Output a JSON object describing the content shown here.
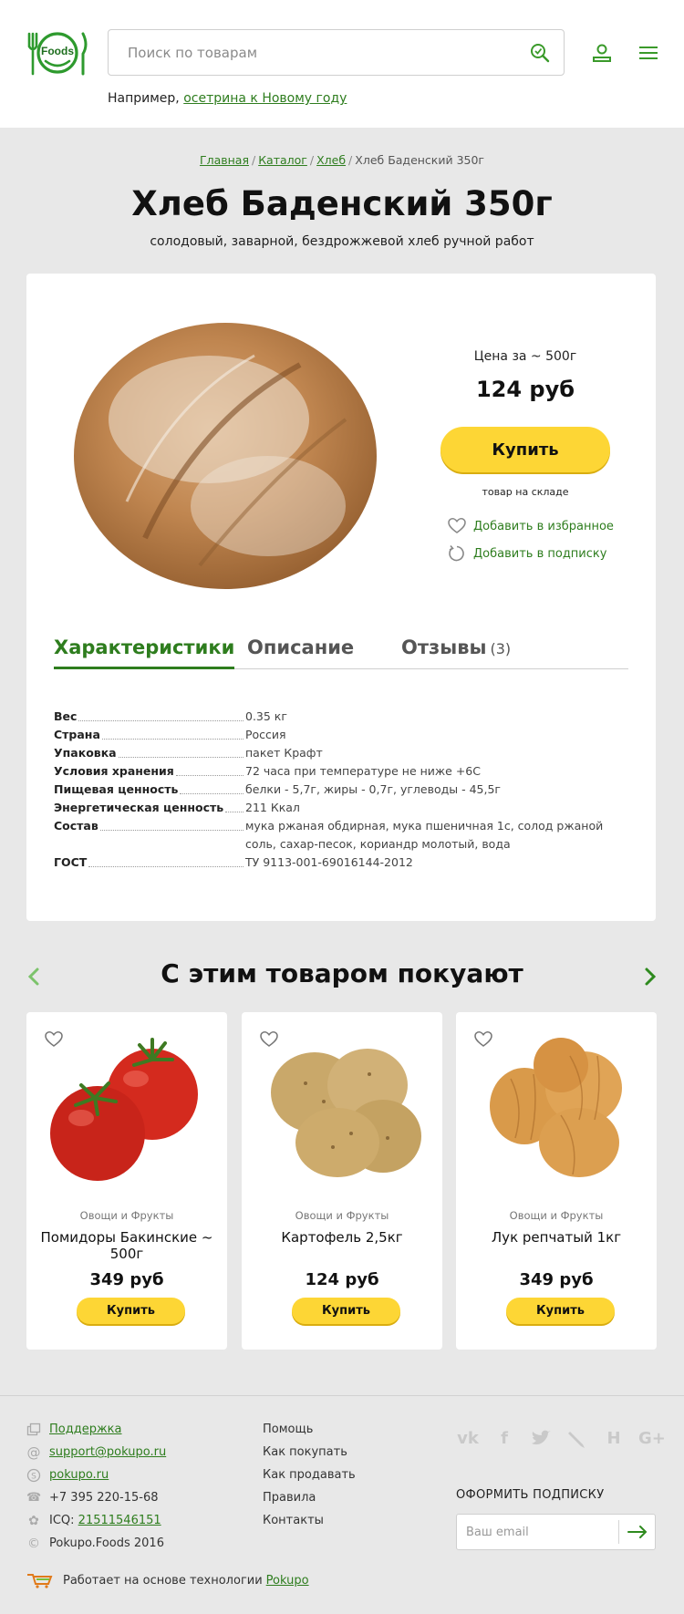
{
  "header": {
    "logo_text": "Foods",
    "search_placeholder": "Поиск по товарам",
    "example_prefix": "Например,",
    "example_link": "осетрина к Новому году"
  },
  "breadcrumb": [
    {
      "label": "Главная",
      "link": true
    },
    {
      "label": "Каталог",
      "link": true
    },
    {
      "label": "Хлеб",
      "link": true
    },
    {
      "label": "Хлеб Баденский 350г",
      "link": false
    }
  ],
  "product": {
    "title": "Хлеб Баденский 350г",
    "subtitle": "солодовый, заварной, бездрожжевой хлеб ручной работ",
    "price_label": "Цена за ~ 500г",
    "price": "124 руб",
    "buy_label": "Купить",
    "stock": "товар на складе",
    "favorite_label": "Добавить в избранное",
    "subscribe_label": "Добавить в подписку"
  },
  "tabs": [
    {
      "label": "Характеристики",
      "count": "",
      "active": true
    },
    {
      "label": "Описание",
      "count": "",
      "active": false
    },
    {
      "label": "Отзывы",
      "count": "(3)",
      "active": false
    }
  ],
  "specs": [
    {
      "name": "Вес",
      "value": "0.35 кг"
    },
    {
      "name": "Страна",
      "value": "Россия"
    },
    {
      "name": "Упаковка",
      "value": "пакет Крафт"
    },
    {
      "name": "Условия хранения",
      "value": "72 часа при температуре не ниже +6С"
    },
    {
      "name": "Пищевая ценность",
      "value": "белки - 5,7г, жиры - 0,7г, углеводы - 45,5г"
    },
    {
      "name": "Энергетическая ценность",
      "value": "211 Ккал"
    },
    {
      "name": "Состав",
      "value": "мука ржаная обдирная, мука пшеничная 1с, солод ржаной соль, сахар-песок, кориандр молотый, вода"
    },
    {
      "name": "ГОСТ",
      "value": "ТУ 9113-001-69016144-2012"
    }
  ],
  "related": {
    "title": "С этим товаром покуают",
    "items": [
      {
        "category": "Овощи и Фрукты",
        "name": "Помидоры Бакинские ~ 500г",
        "price": "349 руб",
        "buy_label": "Купить",
        "image": "tomatoes"
      },
      {
        "category": "Овощи и Фрукты",
        "name": "Картофель 2,5кг",
        "price": "124 руб",
        "buy_label": "Купить",
        "image": "potatoes"
      },
      {
        "category": "Овощи и Фрукты",
        "name": "Лук репчатый 1кг",
        "price": "349 руб",
        "buy_label": "Купить",
        "image": "onions"
      }
    ]
  },
  "footer": {
    "contacts": [
      {
        "icon": "support-icon",
        "text": "Поддержка",
        "link": true
      },
      {
        "icon": "at-icon",
        "text": "support@pokupo.ru",
        "link": true
      },
      {
        "icon": "skype-icon",
        "text": "pokupo.ru",
        "link": true
      },
      {
        "icon": "phone-icon",
        "text": "+7 395 220-15-68",
        "link": false
      },
      {
        "icon": "icq-icon",
        "text": "ICQ:",
        "link_text": "21511546151",
        "link": false
      },
      {
        "icon": "copyright-icon",
        "text": "Pokupo.Foods 2016",
        "link": false
      }
    ],
    "links": [
      "Помощь",
      "Как покупать",
      "Как продавать",
      "Правила",
      "Контакты"
    ],
    "social": [
      "vk-icon",
      "facebook-icon",
      "twitter-icon",
      "livejournal-icon",
      "habr-icon",
      "google-plus-icon"
    ],
    "subscribe_title": "ОФОРМИТЬ ПОДПИСКУ",
    "email_placeholder": "Ваш email",
    "powered_text": "Работает на основе технологии",
    "powered_link": "Pokupo"
  },
  "colors": {
    "brand_green": "#2e7d1e",
    "button_yellow": "#fdd635",
    "page_bg": "#e8e8e8"
  }
}
